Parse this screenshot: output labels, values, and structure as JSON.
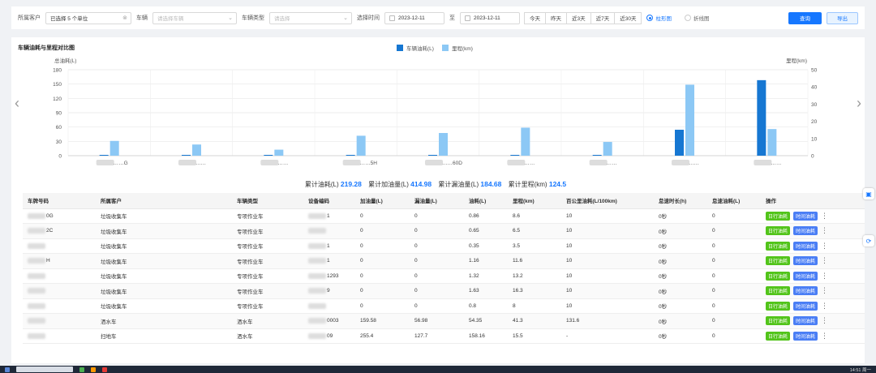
{
  "filters": {
    "customer_label": "所属客户",
    "customer_value": "已选择 5 个单位",
    "vehicle_label": "车辆",
    "vehicle_placeholder": "请选择车辆",
    "vehicle_type_label": "车辆类型",
    "vehicle_type_placeholder": "请选择",
    "time_label": "选择时间",
    "date_from": "2023-12-11",
    "date_sep": "至",
    "date_to": "2023-12-11",
    "quick": [
      "今天",
      "昨天",
      "近3天",
      "近7天",
      "近30天"
    ],
    "chart_mode_bar": "柱形图",
    "chart_mode_line": "折线图",
    "query_button": "查询",
    "export_button": "导出"
  },
  "chart": {
    "title": "车辆油耗与里程对比图",
    "legend_fuel": "车辆油耗(L)",
    "legend_mileage": "里程(km)",
    "left_axis_label": "总油耗(L)",
    "right_axis_label": "里程(km)",
    "left_ticks": [
      "180",
      "150",
      "120",
      "90",
      "60",
      "30",
      "0"
    ],
    "right_ticks": [
      "50",
      "40",
      "30",
      "20",
      "10",
      "0"
    ],
    "colors": {
      "fuel": "#1677d2",
      "mileage": "#8cc8f5"
    }
  },
  "chart_data": {
    "type": "bar",
    "categories": [
      "……G",
      "……",
      "……",
      "……5H",
      "……60D",
      "……",
      "……",
      "……",
      "……"
    ],
    "series": [
      {
        "name": "车辆油耗(L)",
        "axis": "left",
        "values": [
          0.86,
          0.65,
          0.35,
          1.16,
          1.32,
          1.63,
          0.8,
          54.35,
          158.16
        ]
      },
      {
        "name": "里程(km)",
        "axis": "right",
        "values": [
          8.6,
          6.5,
          3.5,
          11.6,
          13.2,
          16.3,
          8,
          41.3,
          15.5
        ]
      }
    ],
    "ylim_left": [
      0,
      180
    ],
    "ylim_right": [
      0,
      50
    ],
    "grid": true,
    "legend_position": "top-center"
  },
  "summary": {
    "total_fuel_label": "累计油耗(L)",
    "total_fuel": "219.28",
    "total_refuel_label": "累计加油量(L)",
    "total_refuel": "414.98",
    "total_leak_label": "累计漏油量(L)",
    "total_leak": "184.68",
    "total_mileage_label": "累计里程(km)",
    "total_mileage": "124.5"
  },
  "table": {
    "headers": [
      "车牌号码",
      "所属客户",
      "车辆类型",
      "设备编码",
      "加油量(L)",
      "漏油量(L)",
      "油耗(L)",
      "里程(km)",
      "百公里油耗(L/100km)",
      "怠速时长(h)",
      "怠速油耗(L)",
      "操作"
    ],
    "rows": [
      [
        "0G",
        "垃圾收集车",
        "专项作业车",
        "1",
        "0",
        "0",
        "0.86",
        "8.6",
        "10",
        "0秒",
        "0"
      ],
      [
        "2C",
        "垃圾收集车",
        "专项作业车",
        "",
        "0",
        "0",
        "0.65",
        "6.5",
        "10",
        "0秒",
        "0"
      ],
      [
        "",
        "垃圾收集车",
        "专项作业车",
        "1",
        "0",
        "0",
        "0.35",
        "3.5",
        "10",
        "0秒",
        "0"
      ],
      [
        "H",
        "垃圾收集车",
        "专项作业车",
        "1",
        "0",
        "0",
        "1.16",
        "11.6",
        "10",
        "0秒",
        "0"
      ],
      [
        "",
        "垃圾收集车",
        "专项作业车",
        "1293",
        "0",
        "0",
        "1.32",
        "13.2",
        "10",
        "0秒",
        "0"
      ],
      [
        "",
        "垃圾收集车",
        "专项作业车",
        "9",
        "0",
        "0",
        "1.63",
        "16.3",
        "10",
        "0秒",
        "0"
      ],
      [
        "",
        "垃圾收集车",
        "专项作业车",
        "",
        "0",
        "0",
        "0.8",
        "8",
        "10",
        "0秒",
        "0"
      ],
      [
        "",
        "洒水车",
        "洒水车",
        "0003",
        "159.58",
        "56.98",
        "54.35",
        "41.3",
        "131.6",
        "0秒",
        "0"
      ],
      [
        "",
        "扫地车",
        "洒水车",
        "09",
        "255.4",
        "127.7",
        "158.16",
        "15.5",
        "-",
        "0秒",
        "0"
      ]
    ],
    "op_daily": "日行油耗",
    "op_time": "时间油耗",
    "op_more": "⋮"
  },
  "taskbar": {
    "search_text": "",
    "clock": "14:51 周一"
  }
}
